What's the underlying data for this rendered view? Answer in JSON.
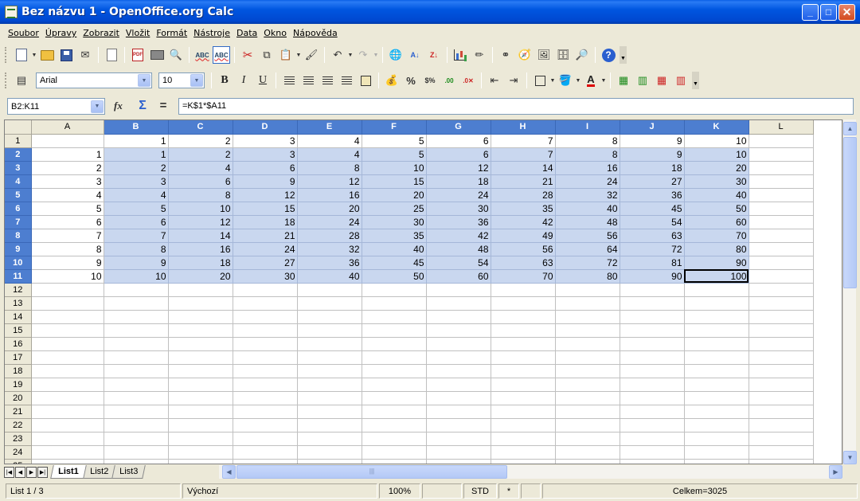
{
  "window": {
    "title": "Bez názvu 1 - OpenOffice.org Calc"
  },
  "menu": [
    "Soubor",
    "Úpravy",
    "Zobrazit",
    "Vložit",
    "Formát",
    "Nástroje",
    "Data",
    "Okno",
    "Nápověda"
  ],
  "format_toolbar": {
    "font_name": "Arial",
    "font_size": "10"
  },
  "formula_bar": {
    "name_box": "B2:K11",
    "formula": "=K$1*$A11"
  },
  "grid": {
    "columns": [
      "A",
      "B",
      "C",
      "D",
      "E",
      "F",
      "G",
      "H",
      "I",
      "J",
      "K",
      "L"
    ],
    "selected_columns": [
      "B",
      "C",
      "D",
      "E",
      "F",
      "G",
      "H",
      "I",
      "J",
      "K"
    ],
    "selected_rows": [
      2,
      3,
      4,
      5,
      6,
      7,
      8,
      9,
      10,
      11
    ],
    "active_cell": "K11",
    "visible_row_count": 25,
    "rows": [
      [
        "",
        "1",
        "2",
        "3",
        "4",
        "5",
        "6",
        "7",
        "8",
        "9",
        "10",
        ""
      ],
      [
        "1",
        "1",
        "2",
        "3",
        "4",
        "5",
        "6",
        "7",
        "8",
        "9",
        "10",
        ""
      ],
      [
        "2",
        "2",
        "4",
        "6",
        "8",
        "10",
        "12",
        "14",
        "16",
        "18",
        "20",
        ""
      ],
      [
        "3",
        "3",
        "6",
        "9",
        "12",
        "15",
        "18",
        "21",
        "24",
        "27",
        "30",
        ""
      ],
      [
        "4",
        "4",
        "8",
        "12",
        "16",
        "20",
        "24",
        "28",
        "32",
        "36",
        "40",
        ""
      ],
      [
        "5",
        "5",
        "10",
        "15",
        "20",
        "25",
        "30",
        "35",
        "40",
        "45",
        "50",
        ""
      ],
      [
        "6",
        "6",
        "12",
        "18",
        "24",
        "30",
        "36",
        "42",
        "48",
        "54",
        "60",
        ""
      ],
      [
        "7",
        "7",
        "14",
        "21",
        "28",
        "35",
        "42",
        "49",
        "56",
        "63",
        "70",
        ""
      ],
      [
        "8",
        "8",
        "16",
        "24",
        "32",
        "40",
        "48",
        "56",
        "64",
        "72",
        "80",
        ""
      ],
      [
        "9",
        "9",
        "18",
        "27",
        "36",
        "45",
        "54",
        "63",
        "72",
        "81",
        "90",
        ""
      ],
      [
        "10",
        "10",
        "20",
        "30",
        "40",
        "50",
        "60",
        "70",
        "80",
        "90",
        "100",
        ""
      ]
    ]
  },
  "sheets": {
    "tabs": [
      "List1",
      "List2",
      "List3"
    ],
    "active": "List1"
  },
  "status": {
    "sheet": "List 1 / 3",
    "style": "Výchozí",
    "zoom": "100%",
    "mode": "STD",
    "modified": "*",
    "sum": "Celkem=3025"
  }
}
